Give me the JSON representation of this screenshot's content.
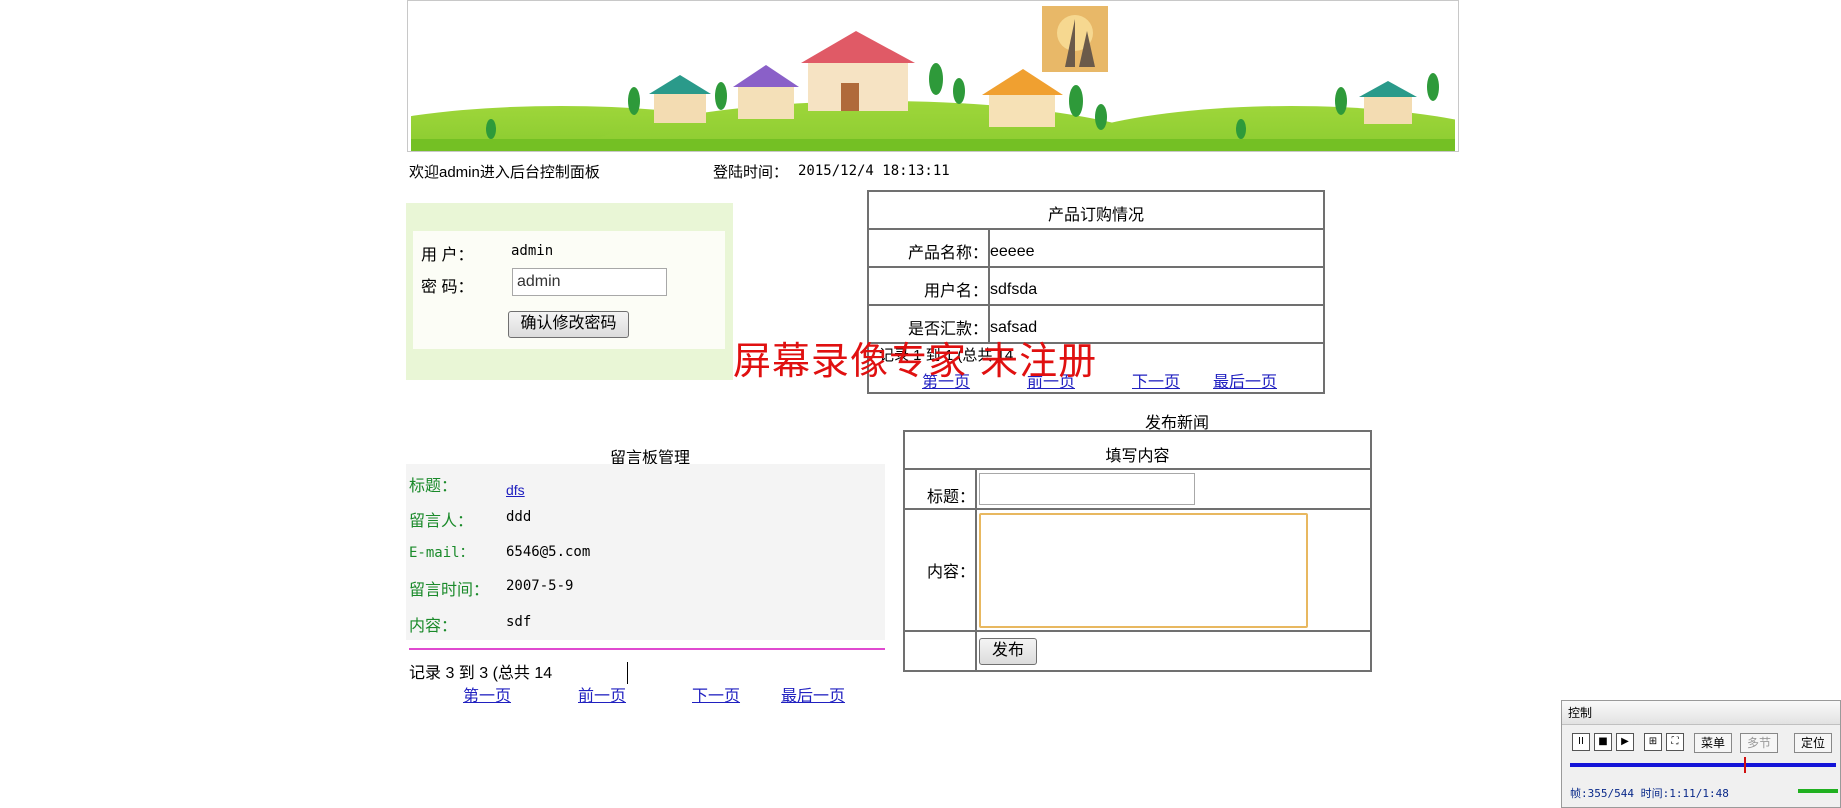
{
  "header": {
    "welcome": "欢迎admin进入后台控制面板",
    "login_time_label": "登陆时间：",
    "login_time_value": "2015/12/4 18:13:11"
  },
  "password_panel": {
    "user_label": "用 户：",
    "user_value": "admin",
    "password_label": "密 码：",
    "password_value": "admin",
    "confirm_button": "确认修改密码"
  },
  "order_table": {
    "title": "产品订购情况",
    "rows": [
      {
        "label": "产品名称：",
        "value": "eeeee"
      },
      {
        "label": "用户名：",
        "value": "sdfsda"
      },
      {
        "label": "是否汇款：",
        "value": "safsad"
      }
    ],
    "records_text": "记录 1 到 1 (总共 14",
    "pager": [
      "第一页",
      "前一页",
      "下一页",
      "最后一页"
    ]
  },
  "guestbook": {
    "title": "留言板管理",
    "fields": [
      {
        "label": "标题：",
        "value": "dfs"
      },
      {
        "label": "留言人：",
        "value": "ddd"
      },
      {
        "label": "E-mail：",
        "value": "6546@5.com"
      },
      {
        "label": "留言时间：",
        "value": "2007-5-9"
      },
      {
        "label": "内容：",
        "value": "sdf"
      }
    ],
    "records_text": "记录 3 到 3 (总共 14",
    "pager": [
      "第一页",
      "前一页",
      "下一页",
      "最后一页"
    ]
  },
  "news_form": {
    "heading": "发布新闻",
    "table_title": "填写内容",
    "title_label": "标题：",
    "content_label": "内容：",
    "title_value": "",
    "content_value": "",
    "publish_button": "发布"
  },
  "watermark": "屏幕录像专家 未注册",
  "recorder": {
    "title": "控制",
    "menu_button": "菜单",
    "multi_button": "多节",
    "locate_button": "定位",
    "status": "帧:355/544 时间:1:11/1:48",
    "progress": 0.653
  },
  "colors": {
    "link": "#2020c0",
    "guestbook_label": "#1a8a2a",
    "watermark": "#e01010",
    "divider": "#e04ad0",
    "panel_bg": "#e9f6d6"
  }
}
